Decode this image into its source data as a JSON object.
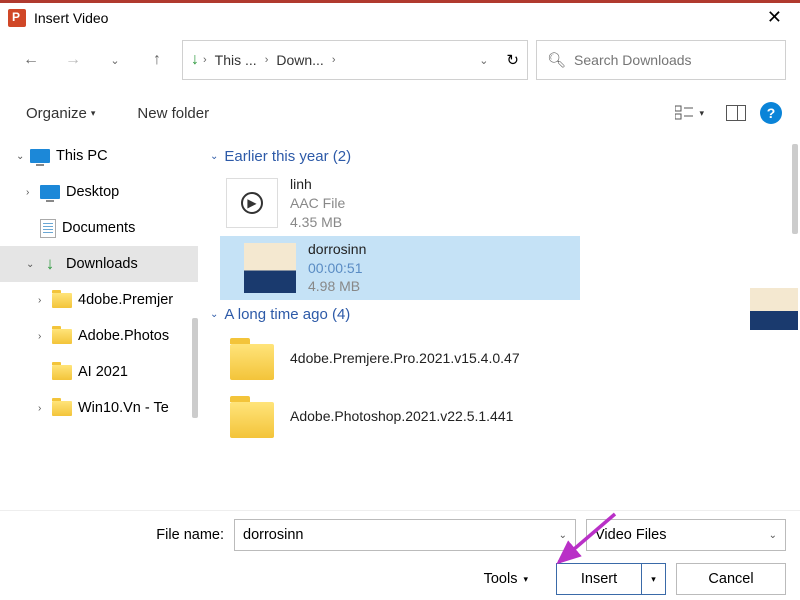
{
  "window": {
    "title": "Insert Video"
  },
  "path": {
    "seg1": "This ...",
    "seg2": "Down..."
  },
  "search": {
    "placeholder": "Search Downloads"
  },
  "toolbar": {
    "organize": "Organize",
    "new_folder": "New folder"
  },
  "tree": {
    "this_pc": "This PC",
    "desktop": "Desktop",
    "documents": "Documents",
    "downloads": "Downloads",
    "items": [
      "4dobe.Premjer",
      "Adobe.Photos",
      "AI 2021",
      "Win10.Vn - Te"
    ]
  },
  "groups": {
    "earlier": {
      "label": "Earlier this year (2)"
    },
    "long_ago": {
      "label": "A long time ago (4)"
    }
  },
  "files": {
    "linh": {
      "name": "linh",
      "type": "AAC File",
      "size": "4.35 MB"
    },
    "dorrosinn": {
      "name": "dorrosinn",
      "duration": "00:00:51",
      "size": "4.98 MB"
    },
    "premiere": {
      "name": "4dobe.Premjere.Pro.2021.v15.4.0.47"
    },
    "photoshop": {
      "name": "Adobe.Photoshop.2021.v22.5.1.441"
    }
  },
  "footer": {
    "filename_label": "File name:",
    "filename_value": "dorrosinn",
    "filetype": "Video Files",
    "tools": "Tools",
    "insert": "Insert",
    "cancel": "Cancel"
  }
}
